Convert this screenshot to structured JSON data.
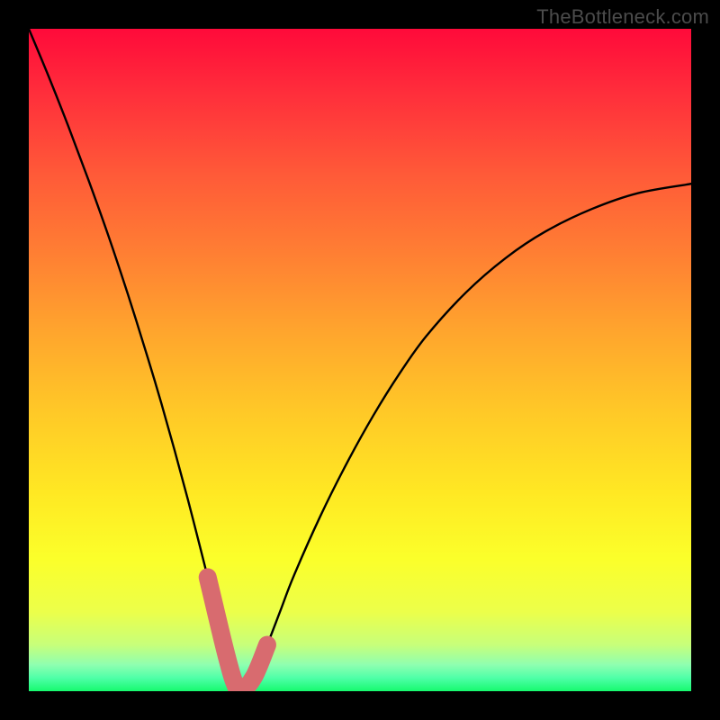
{
  "watermark": "TheBottleneck.com",
  "colors": {
    "background": "#000000",
    "curve": "#000000",
    "highlight_stroke": "#d86b6f",
    "highlight_fill": "none",
    "gradient_top": "#ff0a3a",
    "gradient_bottom": "#16fa6e"
  },
  "chart_data": {
    "type": "line",
    "title": "",
    "xlabel": "",
    "ylabel": "",
    "xlim": [
      0,
      100
    ],
    "ylim": [
      0,
      100
    ],
    "series": [
      {
        "name": "bottleneck-curve",
        "x": [
          0,
          3,
          6,
          9,
          12,
          15,
          18,
          20,
          22,
          24,
          26,
          27,
          28,
          29,
          30,
          31,
          32,
          34,
          36,
          38,
          40,
          44,
          48,
          52,
          56,
          60,
          66,
          72,
          78,
          85,
          92,
          100
        ],
        "y": [
          100,
          92.8,
          85.2,
          77.2,
          68.8,
          59.8,
          50.2,
          43.5,
          36.4,
          29.0,
          21.2,
          17.2,
          13.0,
          8.8,
          4.8,
          1.4,
          0.0,
          2.2,
          7.0,
          12.2,
          17.4,
          26.4,
          34.4,
          41.6,
          48.0,
          53.6,
          60.2,
          65.4,
          69.4,
          72.8,
          75.2,
          76.6
        ]
      }
    ],
    "highlight_region": {
      "x_start": 27,
      "x_end": 36,
      "description": "rounded U-shaped segment near curve minimum"
    }
  }
}
